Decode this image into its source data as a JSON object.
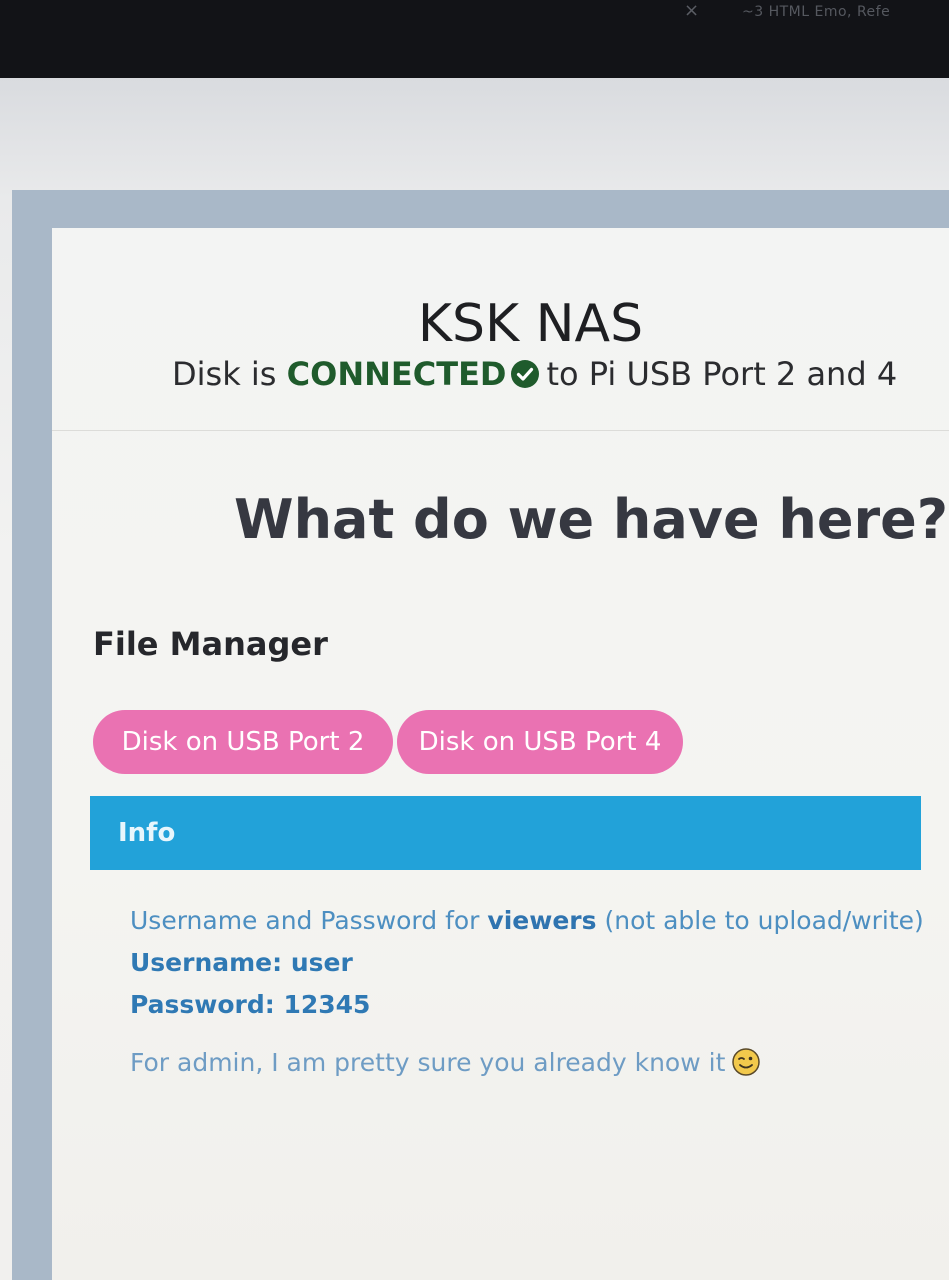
{
  "browser": {
    "tab_close_glyph": "×",
    "tab_title": "~3 HTML Emo, Refe"
  },
  "header": {
    "title": "KSK NAS",
    "status_prefix": "Disk is",
    "status_value": "CONNECTED",
    "status_suffix": "to Pi USB Port 2 and 4"
  },
  "main": {
    "heading": "What do we have here?",
    "file_manager": {
      "heading": "File Manager",
      "buttons": [
        {
          "label": "Disk on USB Port 2"
        },
        {
          "label": "Disk on USB Port 4"
        }
      ]
    },
    "info": {
      "label": "Info",
      "line1_prefix": "Username and Password for",
      "line1_emphasis": "viewers",
      "line1_suffix": "(not able to upload/write)",
      "username_line": "Username: user",
      "password_line": "Password: 12345",
      "admin_note": "For admin, I am pretty sure you already know it"
    }
  },
  "icons": {
    "status_icon": "check-circle-icon",
    "admin_note_icon": "wink-emoji-icon"
  },
  "colors": {
    "button_pink": "#ea72b2",
    "info_bar_blue": "#22a2d9",
    "connected_green": "#1f5b2c",
    "info_text_blue": "#4d8fc1"
  }
}
